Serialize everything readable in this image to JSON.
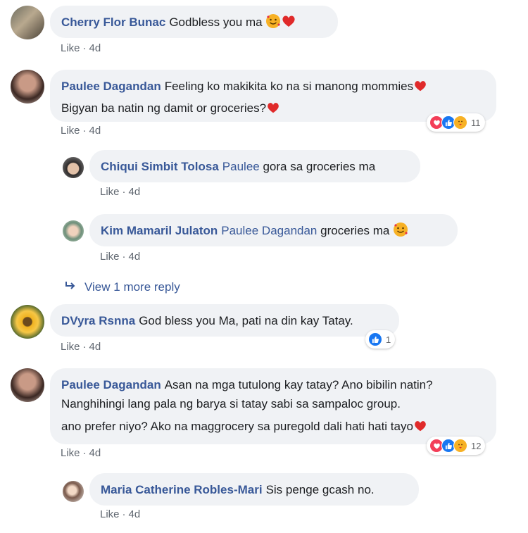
{
  "comments": [
    {
      "name": "Cherry Flor Bunac",
      "text": "Godbless you ma",
      "like": "Like",
      "time": "4d"
    },
    {
      "name": "Paulee Dagandan",
      "line1": "Feeling ko makikita ko na si manong mommies",
      "line2": "Bigyan ba natin ng damit or groceries?",
      "like": "Like",
      "time": "4d",
      "reaction_count": "11"
    },
    {
      "name": "Chiqui Simbit Tolosa",
      "tag": "Paulee",
      "text": "gora sa groceries ma",
      "like": "Like",
      "time": "4d"
    },
    {
      "name": "Kim Mamaril Julaton",
      "tag": "Paulee Dagandan",
      "text": "groceries ma",
      "like": "Like",
      "time": "4d"
    },
    {
      "name": "DVyra Rsnna",
      "text": "God bless you Ma, pati na din kay Tatay.",
      "like": "Like",
      "time": "4d",
      "reaction_count": "1"
    },
    {
      "name": "Paulee Dagandan",
      "line1": "Asan na mga tutulong kay tatay? Ano bibilin natin?",
      "line2": "Nanghihingi lang pala ng barya si tatay sabi sa sampaloc group.",
      "line3": "ano prefer niyo? Ako na maggrocery sa puregold dali hati hati tayo",
      "like": "Like",
      "time": "4d",
      "reaction_count": "12"
    },
    {
      "name": "Maria Catherine Robles-Mari",
      "text": "Sis penge gcash no.",
      "like": "Like",
      "time": "4d"
    }
  ],
  "view_more": "View 1 more reply",
  "colors": {
    "link": "#385898",
    "bubble": "#f0f2f5",
    "like_blue": "#1877f2",
    "heart_red": "#f33e58",
    "care_yellow": "#f7b125"
  }
}
